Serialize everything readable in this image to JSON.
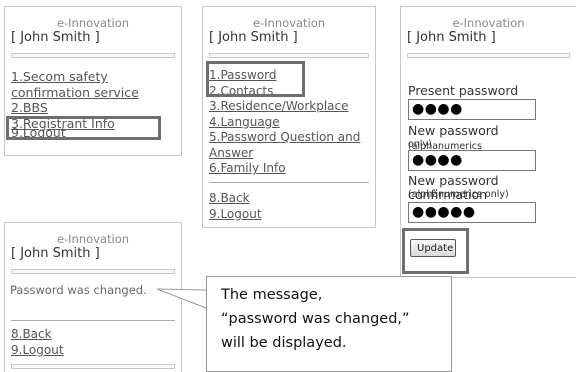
{
  "brand": "e-Innovation",
  "user": "[ John Smith ]",
  "panel1": {
    "menu": [
      "1.Secom safety",
      "confirmation service",
      "2.BBS",
      "3.Registrant Info",
      "9.Logout"
    ]
  },
  "panel2": {
    "menu": [
      "1.Password",
      "2.Contacts",
      "3.Residence/Workplace",
      "4.Language",
      "5.Password Question and",
      "Answer",
      "6.Family Info"
    ],
    "back": "8.Back",
    "logout": "9.Logout"
  },
  "panel3": {
    "present_label": "Present password",
    "present_value": "●●●●",
    "new_label": "New password",
    "new_note": "(alphanumerics",
    "new_note2": "only)",
    "new_value": "●●●●",
    "confirm_label": "New password confirmation",
    "confirm_note": "(alphanumerics only)",
    "confirm_value": "●●●●●",
    "update_button": "Update"
  },
  "panel4": {
    "message": "Password was changed.",
    "back": "8.Back",
    "logout": "9.Logout"
  },
  "callout": {
    "line1": "The message,",
    "line2": "“password was changed,”",
    "line3": "will be displayed."
  }
}
